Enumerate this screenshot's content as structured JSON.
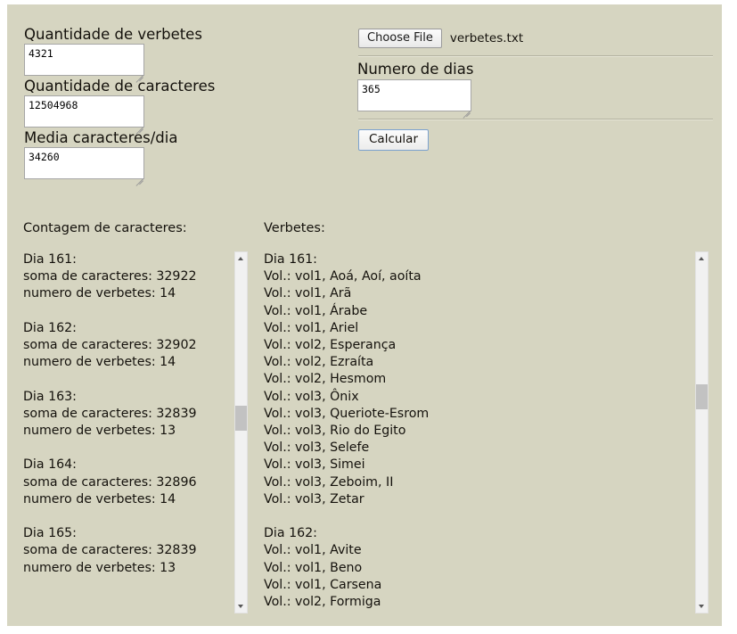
{
  "form": {
    "fields": [
      {
        "label": "Quantidade de verbetes",
        "value": "4321"
      },
      {
        "label": "Quantidade de caracteres",
        "value": "12504968"
      },
      {
        "label": "Media caracteres/dia",
        "value": "34260"
      }
    ],
    "file_input": {
      "button_label": "Choose File",
      "file_name": "verbetes.txt"
    },
    "days_field": {
      "label": "Numero de dias",
      "value": "365"
    },
    "calculate_button": "Calcular"
  },
  "results": {
    "left": {
      "heading": "Contagem de caracteres:",
      "text": "Dia 161:\nsoma de caracteres: 32922\nnumero de verbetes: 14\n\nDia 162:\nsoma de caracteres: 32902\nnumero de verbetes: 14\n\nDia 163:\nsoma de caracteres: 32839\nnumero de verbetes: 13\n\nDia 164:\nsoma de caracteres: 32896\nnumero de verbetes: 14\n\nDia 165:\nsoma de caracteres: 32839\nnumero de verbetes: 13\n",
      "days": [
        {
          "day": "Dia 161:",
          "soma": "soma de caracteres: 32922",
          "verbetes": "numero de verbetes: 14"
        },
        {
          "day": "Dia 162:",
          "soma": "soma de caracteres: 32902",
          "verbetes": "numero de verbetes: 14"
        },
        {
          "day": "Dia 163:",
          "soma": "soma de caracteres: 32839",
          "verbetes": "numero de verbetes: 13"
        },
        {
          "day": "Dia 164:",
          "soma": "soma de caracteres: 32896",
          "verbetes": "numero de verbetes: 14"
        },
        {
          "day": "Dia 165:",
          "soma": "soma de caracteres: 32839",
          "verbetes": "numero de verbetes: 13"
        }
      ]
    },
    "right": {
      "heading": "Verbetes:",
      "text": "Dia 161:\nVol.: vol1, Aoá, Aoí, aoíta\nVol.: vol1, Arã\nVol.: vol1, Árabe\nVol.: vol1, Ariel\nVol.: vol2, Esperança\nVol.: vol2, Ezraíta\nVol.: vol2, Hesmom\nVol.: vol3, Ônix\nVol.: vol3, Queriote-Esrom\nVol.: vol3, Rio do Egito\nVol.: vol3, Selefe\nVol.: vol3, Simei\nVol.: vol3, Zeboim, II\nVol.: vol3, Zetar\n\nDia 162:\nVol.: vol1, Avite\nVol.: vol1, Beno\nVol.: vol1, Carsena\nVol.: vol2, Formiga"
    }
  },
  "scrollbars": {
    "left": {
      "up_arrow": "scroll-up",
      "down_arrow": "scroll-down"
    },
    "right": {
      "up_arrow": "scroll-up",
      "down_arrow": "scroll-down"
    }
  },
  "colors": {
    "page_background": "#d6d5c1",
    "text": "#14110c",
    "input_background": "#ffffff",
    "accent_border": "#7ba2cf"
  }
}
